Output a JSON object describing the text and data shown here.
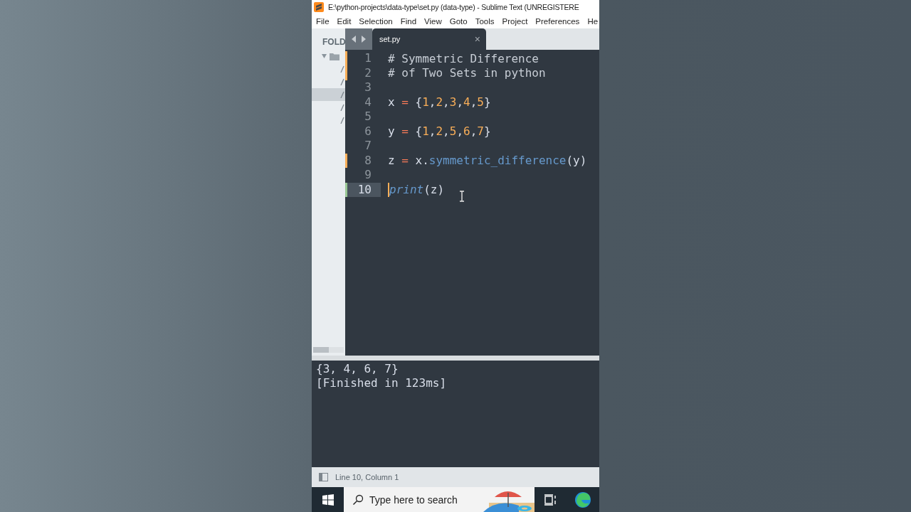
{
  "window": {
    "title": "E:\\python-projects\\data-type\\set.py (data-type) - Sublime Text (UNREGISTERE"
  },
  "menu": [
    "File",
    "Edit",
    "Selection",
    "Find",
    "View",
    "Goto",
    "Tools",
    "Project",
    "Preferences",
    "He"
  ],
  "sidebar": {
    "header": "FOLD",
    "folder": {
      "expanded": true,
      "children": [
        {
          "selected": false
        },
        {
          "selected": false
        },
        {
          "selected": true
        },
        {
          "selected": false
        },
        {
          "selected": false
        }
      ]
    }
  },
  "tabs": [
    {
      "label": "set.py",
      "selected": true,
      "close": "×"
    }
  ],
  "editor": {
    "lines": [
      {
        "number": "1",
        "modified": true,
        "added": false,
        "current": false,
        "tokens": [
          {
            "kind": "comment",
            "text": "# Symmetric Difference"
          }
        ]
      },
      {
        "number": "2",
        "modified": true,
        "added": false,
        "current": false,
        "tokens": [
          {
            "kind": "comment",
            "text": "# of Two Sets in python"
          }
        ]
      },
      {
        "number": "3",
        "modified": false,
        "added": false,
        "current": false
      },
      {
        "number": "4",
        "modified": false,
        "added": false,
        "current": false,
        "tokens": [
          {
            "kind": "name",
            "text": "x"
          },
          {
            "kind": "op",
            "text": " = "
          },
          {
            "kind": "name",
            "text": "{"
          },
          {
            "kind": "num",
            "text": "1"
          },
          {
            "kind": "punct",
            "text": ","
          },
          {
            "kind": "num",
            "text": "2"
          },
          {
            "kind": "punct",
            "text": ","
          },
          {
            "kind": "num",
            "text": "3"
          },
          {
            "kind": "punct",
            "text": ","
          },
          {
            "kind": "num",
            "text": "4"
          },
          {
            "kind": "punct",
            "text": ","
          },
          {
            "kind": "num",
            "text": "5"
          },
          {
            "kind": "name",
            "text": "}"
          }
        ]
      },
      {
        "number": "5",
        "modified": false,
        "added": false,
        "current": false
      },
      {
        "number": "6",
        "modified": false,
        "added": false,
        "current": false,
        "tokens": [
          {
            "kind": "name",
            "text": "y"
          },
          {
            "kind": "op",
            "text": " = "
          },
          {
            "kind": "name",
            "text": "{"
          },
          {
            "kind": "num",
            "text": "1"
          },
          {
            "kind": "punct",
            "text": ","
          },
          {
            "kind": "num",
            "text": "2"
          },
          {
            "kind": "punct",
            "text": ","
          },
          {
            "kind": "num",
            "text": "5"
          },
          {
            "kind": "punct",
            "text": ","
          },
          {
            "kind": "num",
            "text": "6"
          },
          {
            "kind": "punct",
            "text": ","
          },
          {
            "kind": "num",
            "text": "7"
          },
          {
            "kind": "name",
            "text": "}"
          }
        ]
      },
      {
        "number": "7",
        "modified": false,
        "added": false,
        "current": false
      },
      {
        "number": "8",
        "modified": true,
        "added": false,
        "current": false,
        "tokens": [
          {
            "kind": "name",
            "text": "z"
          },
          {
            "kind": "op",
            "text": " = "
          },
          {
            "kind": "name",
            "text": "x"
          },
          {
            "kind": "punct",
            "text": "."
          },
          {
            "kind": "method",
            "text": "symmetric_difference"
          },
          {
            "kind": "name",
            "text": "(y)"
          }
        ]
      },
      {
        "number": "9",
        "modified": false,
        "added": false,
        "current": false
      },
      {
        "number": "10",
        "modified": false,
        "added": true,
        "current": true,
        "tokens": [
          {
            "kind": "builtin",
            "text": "print"
          },
          {
            "kind": "name",
            "text": "(z)"
          }
        ]
      }
    ]
  },
  "output": {
    "lines": [
      "{3, 4, 6, 7}",
      "[Finished in 123ms]"
    ]
  },
  "status_bar": {
    "position": "Line 10, Column 1"
  },
  "taskbar": {
    "search": {
      "placeholder": "Type here to search"
    }
  }
}
